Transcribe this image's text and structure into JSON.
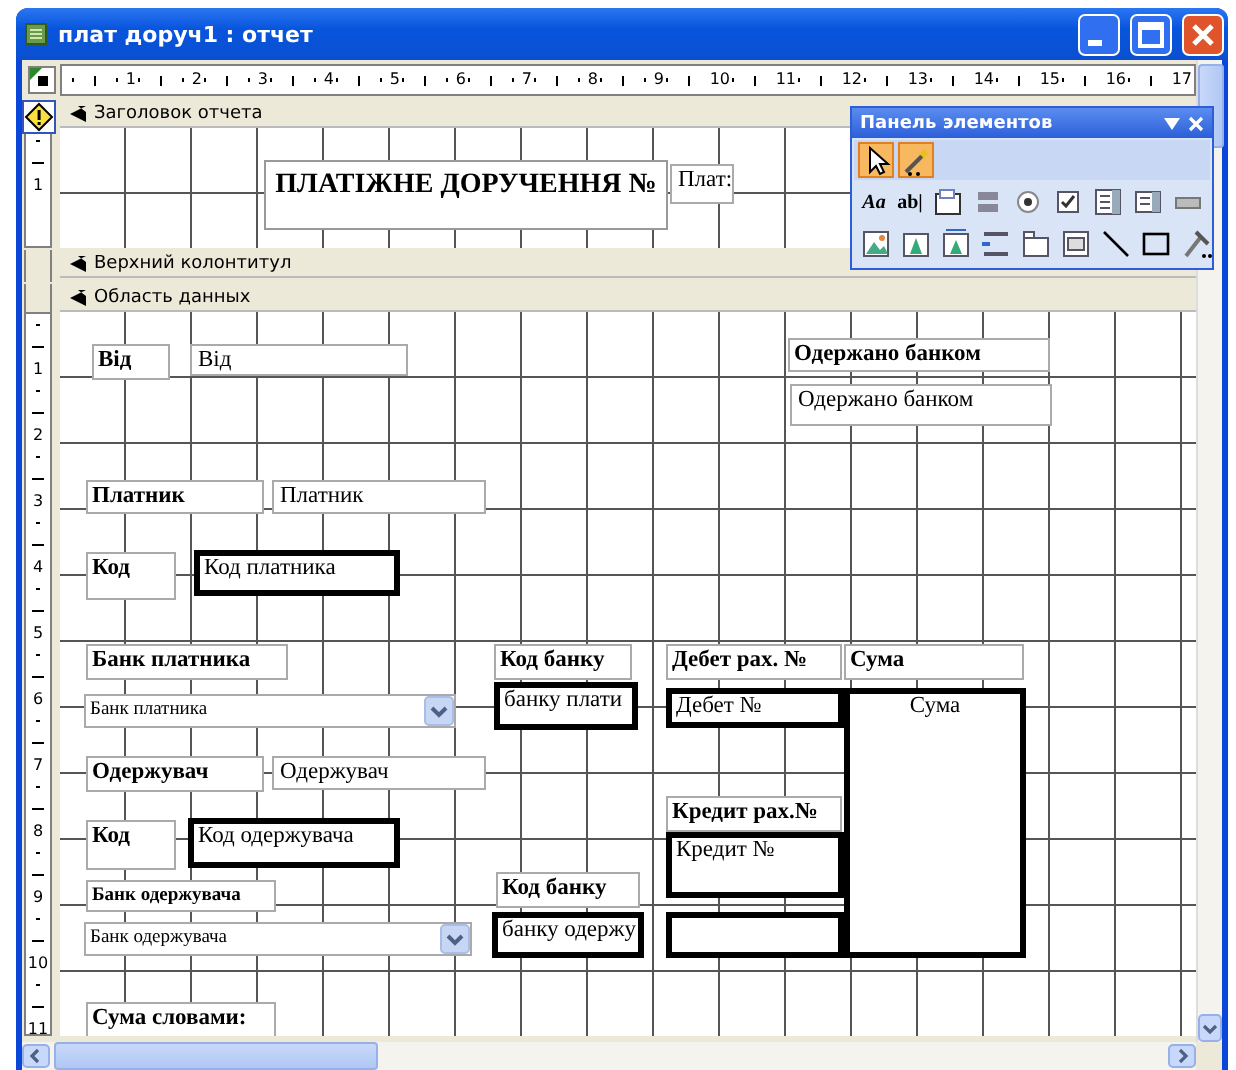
{
  "window": {
    "title": "плат доруч1 : отчет"
  },
  "ruler": {
    "marks": [
      "1",
      "2",
      "3",
      "4",
      "5",
      "6",
      "7",
      "8",
      "9",
      "10",
      "11",
      "12",
      "13",
      "14",
      "15",
      "16",
      "17"
    ]
  },
  "sections": [
    {
      "kind": "header",
      "title": "Заголовок отчета",
      "ruler_marks": [
        "1"
      ],
      "controls": [
        {
          "kind": "title",
          "text": "ПЛАТІЖНЕ ДОРУЧЕННЯ №"
        },
        {
          "kind": "textbox",
          "thick": false,
          "text": "Плат:"
        }
      ]
    },
    {
      "kind": "page_header",
      "title": "Верхний колонтитул"
    },
    {
      "kind": "detail",
      "title": "Область данных",
      "ruler_marks": [
        "1",
        "2",
        "3",
        "4",
        "5",
        "6",
        "7",
        "8",
        "9",
        "10",
        "11"
      ],
      "controls": [
        {
          "kind": "label",
          "text": "Від"
        },
        {
          "kind": "textbox",
          "thick": false,
          "text": "Від"
        },
        {
          "kind": "label",
          "text": "Одержано банком"
        },
        {
          "kind": "textbox",
          "thick": false,
          "text": "Одержано банком"
        },
        {
          "kind": "label",
          "text": "Платник"
        },
        {
          "kind": "textbox",
          "thick": false,
          "text": "Платник"
        },
        {
          "kind": "label",
          "text": "Код"
        },
        {
          "kind": "textbox",
          "thick": true,
          "text": "Код платника"
        },
        {
          "kind": "label",
          "text": "Банк платника"
        },
        {
          "kind": "combo",
          "text": "Банк платника"
        },
        {
          "kind": "label",
          "text": "Код банку"
        },
        {
          "kind": "textbox",
          "thick": true,
          "text": "банку плати"
        },
        {
          "kind": "label",
          "text": "Дебет рах. №"
        },
        {
          "kind": "label",
          "text": "Сума"
        },
        {
          "kind": "textbox",
          "thick": true,
          "text": "Дебет №"
        },
        {
          "kind": "textbox",
          "thick": true,
          "text": "Сума"
        },
        {
          "kind": "label",
          "text": "Одержувач"
        },
        {
          "kind": "textbox",
          "thick": false,
          "text": "Одержувач"
        },
        {
          "kind": "label",
          "text": "Код"
        },
        {
          "kind": "textbox",
          "thick": true,
          "text": "Код одержувача"
        },
        {
          "kind": "label",
          "text": "Кредит рах.№"
        },
        {
          "kind": "textbox",
          "thick": true,
          "text": "Кредит №"
        },
        {
          "kind": "label",
          "text": "Банк одержувача"
        },
        {
          "kind": "combo",
          "text": "Банк одержувача"
        },
        {
          "kind": "label",
          "text": "Код банку"
        },
        {
          "kind": "textbox",
          "thick": true,
          "text": "банку одержу"
        },
        {
          "kind": "textbox",
          "thick": true
        },
        {
          "kind": "label",
          "text": "Сума словами:"
        }
      ]
    }
  ],
  "toolbox": {
    "title": "Панель элементов",
    "rows": [
      [
        {
          "kind": "pointer",
          "pressed": true
        },
        {
          "kind": "wizard",
          "pressed": true
        }
      ],
      [
        {
          "kind": "glyph",
          "label": "Aa",
          "pressed": false
        },
        {
          "kind": "glyph",
          "label": "ab|",
          "pressed": false
        },
        {
          "kind": "group",
          "pressed": false
        },
        {
          "kind": "toggle",
          "pressed": false
        },
        {
          "kind": "radio",
          "pressed": false
        },
        {
          "kind": "checkbox",
          "pressed": false
        },
        {
          "kind": "combo",
          "pressed": false
        },
        {
          "kind": "list",
          "pressed": false
        },
        {
          "kind": "button",
          "pressed": false
        }
      ],
      [
        {
          "kind": "image",
          "pressed": false
        },
        {
          "kind": "object",
          "pressed": false
        },
        {
          "kind": "bound_object",
          "pressed": false
        },
        {
          "kind": "page_break",
          "pressed": false
        },
        {
          "kind": "tab",
          "pressed": false
        },
        {
          "kind": "subform",
          "pressed": false
        },
        {
          "kind": "line",
          "pressed": false
        },
        {
          "kind": "rectangle",
          "pressed": false
        },
        {
          "kind": "more",
          "pressed": false
        }
      ]
    ]
  }
}
